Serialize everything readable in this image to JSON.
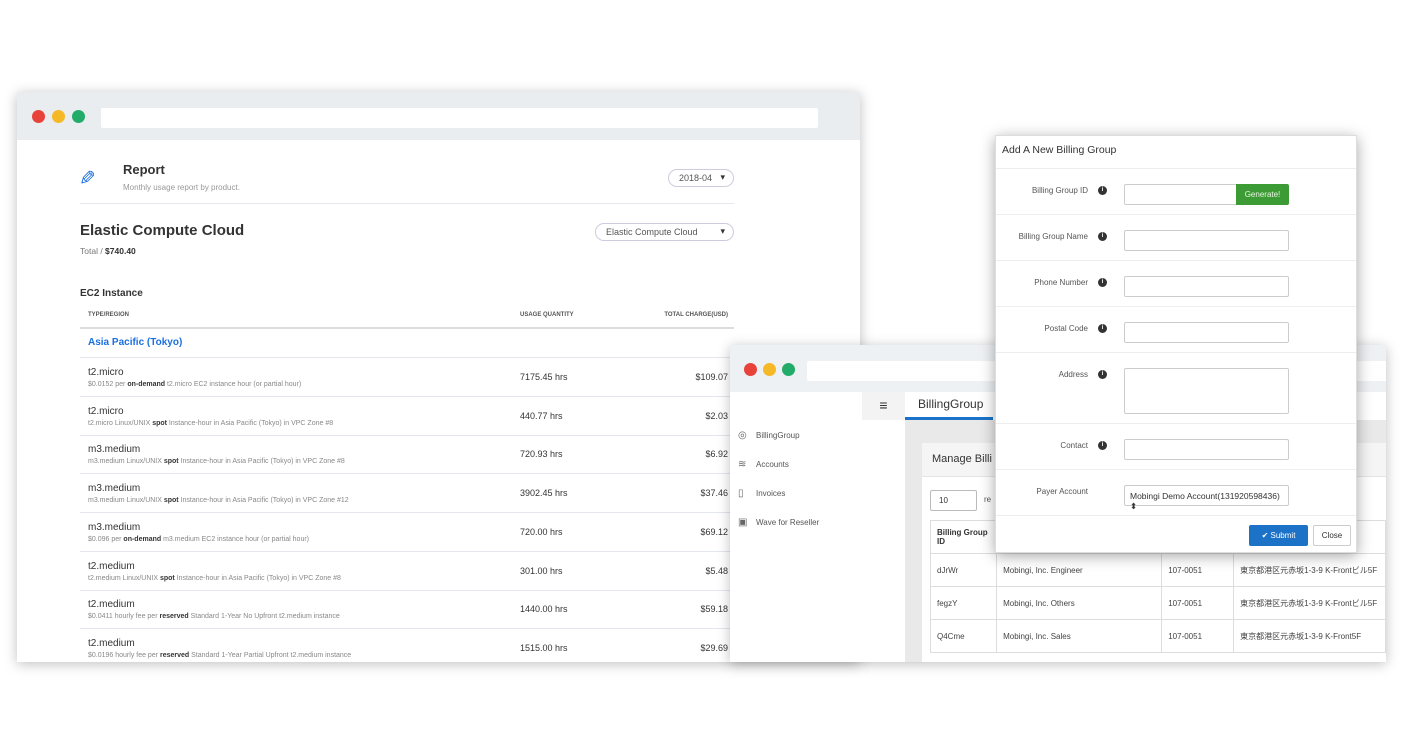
{
  "report": {
    "title": "Report",
    "subtitle": "Monthly usage report by product.",
    "month": "2018-04",
    "product_title": "Elastic Compute Cloud",
    "total_label": "Total / ",
    "total_value": "$740.40",
    "product_select": "Elastic Compute Cloud",
    "section": "EC2 Instance",
    "columns": [
      "TYPE/REGION",
      "USAGE QUANTITY",
      "TOTAL CHARGE(USD)"
    ],
    "region": "Asia Pacific (Tokyo)",
    "rows": [
      {
        "type": "t2.micro",
        "pre": "$0.0152 per ",
        "bold": "on-demand",
        "post": " t2.micro EC2 instance hour (or partial hour)",
        "qty": "7175.45 hrs",
        "charge": "$109.07"
      },
      {
        "type": "t2.micro",
        "pre": "t2.micro Linux/UNIX ",
        "bold": "spot",
        "post": " Instance-hour in Asia Pacific (Tokyo) in VPC Zone #8",
        "qty": "440.77 hrs",
        "charge": "$2.03"
      },
      {
        "type": "m3.medium",
        "pre": "m3.medium Linux/UNIX ",
        "bold": "spot",
        "post": " Instance-hour in Asia Pacific (Tokyo) in VPC Zone #8",
        "qty": "720.93 hrs",
        "charge": "$6.92"
      },
      {
        "type": "m3.medium",
        "pre": "m3.medium Linux/UNIX ",
        "bold": "spot",
        "post": " Instance-hour in Asia Pacific (Tokyo) in VPC Zone #12",
        "qty": "3902.45 hrs",
        "charge": "$37.46"
      },
      {
        "type": "m3.medium",
        "pre": "$0.096 per ",
        "bold": "on-demand",
        "post": " m3.medium EC2 instance hour (or partial hour)",
        "qty": "720.00 hrs",
        "charge": "$69.12"
      },
      {
        "type": "t2.medium",
        "pre": "t2.medium Linux/UNIX ",
        "bold": "spot",
        "post": " Instance-hour in Asia Pacific (Tokyo) in VPC Zone #8",
        "qty": "301.00 hrs",
        "charge": "$5.48"
      },
      {
        "type": "t2.medium",
        "pre": "$0.0411 hourly fee per ",
        "bold": "reserved",
        "post": " Standard 1-Year No Upfront t2.medium instance",
        "qty": "1440.00 hrs",
        "charge": "$59.18"
      },
      {
        "type": "t2.medium",
        "pre": "$0.0196 hourly fee per ",
        "bold": "reserved",
        "post": " Standard 1-Year Partial Upfront t2.medium instance",
        "qty": "1515.00 hrs",
        "charge": "$29.69"
      }
    ]
  },
  "billing": {
    "tab": "BillingGroup",
    "panel_title": "Manage Billi",
    "page_size": "10",
    "page_size_suffix": "re",
    "sidebar": [
      {
        "label": "BillingGroup",
        "icon": "◎"
      },
      {
        "label": "Accounts",
        "icon": "≋"
      },
      {
        "label": "Invoices",
        "icon": "▯"
      },
      {
        "label": "Wave for Reseller",
        "icon": "▣"
      }
    ],
    "header_id": "Billing Group ID",
    "rows": [
      [
        "dJrWr",
        "Mobingi, Inc. Engineer",
        "107-0051",
        "東京都港区元赤坂1-3-9 K-Frontビル5F"
      ],
      [
        "fegzY",
        "Mobingi, Inc. Others",
        "107-0051",
        "東京都港区元赤坂1-3-9 K-Frontビル5F"
      ],
      [
        "Q4Cme",
        "Mobingi, Inc. Sales",
        "107-0051",
        "東京都港区元赤坂1-3-9 K-Front5F"
      ]
    ]
  },
  "modal": {
    "title": "Add A New Billing Group",
    "labels": [
      "Billing Group ID",
      "Billing Group Name",
      "Phone Number",
      "Postal Code",
      "Address",
      "Contact",
      "Payer Account"
    ],
    "generate": "Generate!",
    "payer_value": "Mobingi Demo Account(131920598436)",
    "submit": "Submit",
    "close": "Close"
  },
  "colors": {
    "accent": "#1a6fe0",
    "generate": "#3d9b35",
    "submit": "#1b72c6"
  }
}
